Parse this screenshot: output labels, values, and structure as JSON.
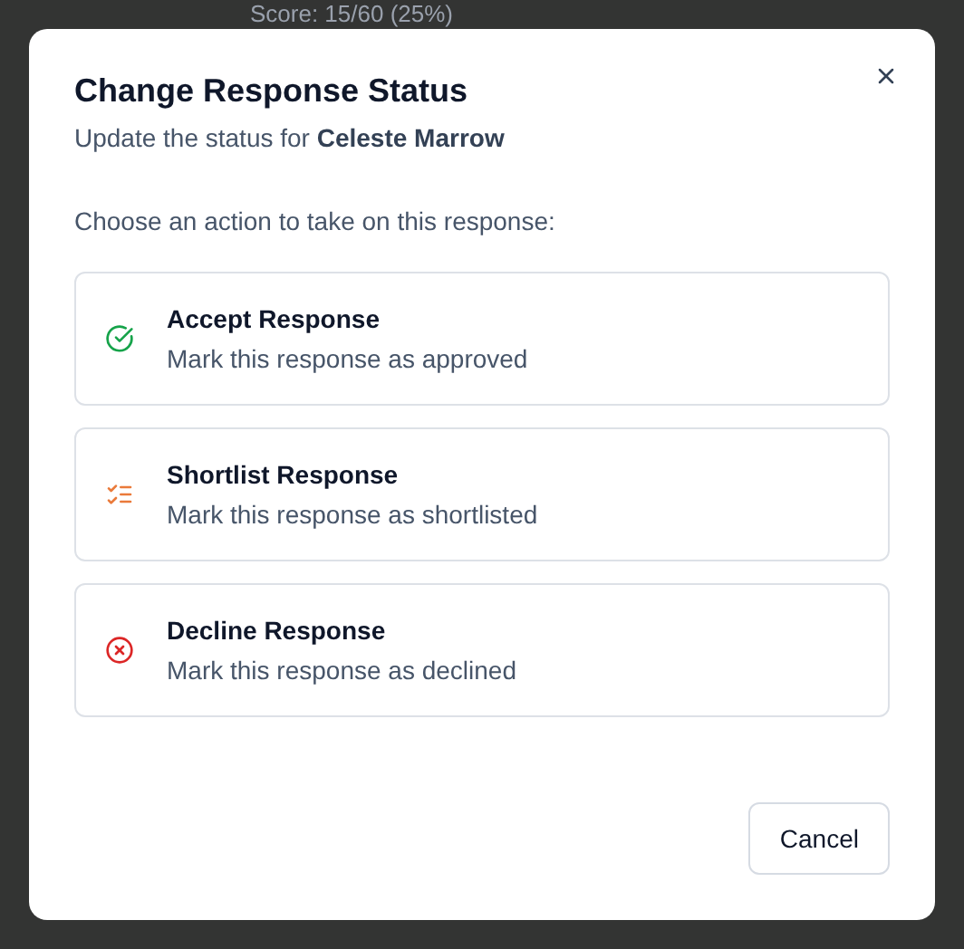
{
  "background": {
    "score": "Score: 15/60 (25%)"
  },
  "dialog": {
    "title": "Change Response Status",
    "subtitle": "Update the status for **Celeste Marrow**",
    "prompt": "Choose an action to take on this response:",
    "options": [
      {
        "kind": "accept",
        "title": "Accept Response",
        "description": "Mark this response as approved"
      },
      {
        "kind": "shortlist",
        "title": "Shortlist Response",
        "description": "Mark this response as shortlisted"
      },
      {
        "kind": "decline",
        "title": "Decline Response",
        "description": "Mark this response as declined"
      }
    ],
    "cancel": "Cancel"
  }
}
